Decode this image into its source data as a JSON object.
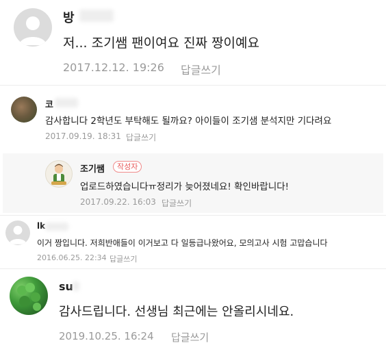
{
  "comments": [
    {
      "author": "방",
      "text": "저... 조기쌤 팬이여요 진짜 짱이예요",
      "date": "2017.12.12. 19:26",
      "reply_label": "답글쓰기"
    },
    {
      "author": "코",
      "text": "감사합니다 2학년도 부탁해도 될까요? 아이들이 조기샘 분석지만 기다려요",
      "date": "2017.09.19. 18:31",
      "reply_label": "답글쓰기",
      "reply": {
        "author": "조기쌤",
        "badge": "작성자",
        "text": "업로드하였습니다ㅠ정리가 늦어졌네요! 확인바랍니다!",
        "date": "2017.09.22. 16:03",
        "reply_label": "답글쓰기"
      }
    },
    {
      "author": "lk",
      "text": "이거 짱입니다. 저희반애들이 이거보고 다 일등급나왔어요, 모의고사 시험 고맙습니다",
      "date": "2016.06.25. 22:34",
      "reply_label": "답글쓰기"
    },
    {
      "author": "su",
      "text": "감사드립니다. 선생님 최근에는 안올리시네요.",
      "date": "2019.10.25. 16:24",
      "reply_label": "답글쓰기"
    }
  ]
}
